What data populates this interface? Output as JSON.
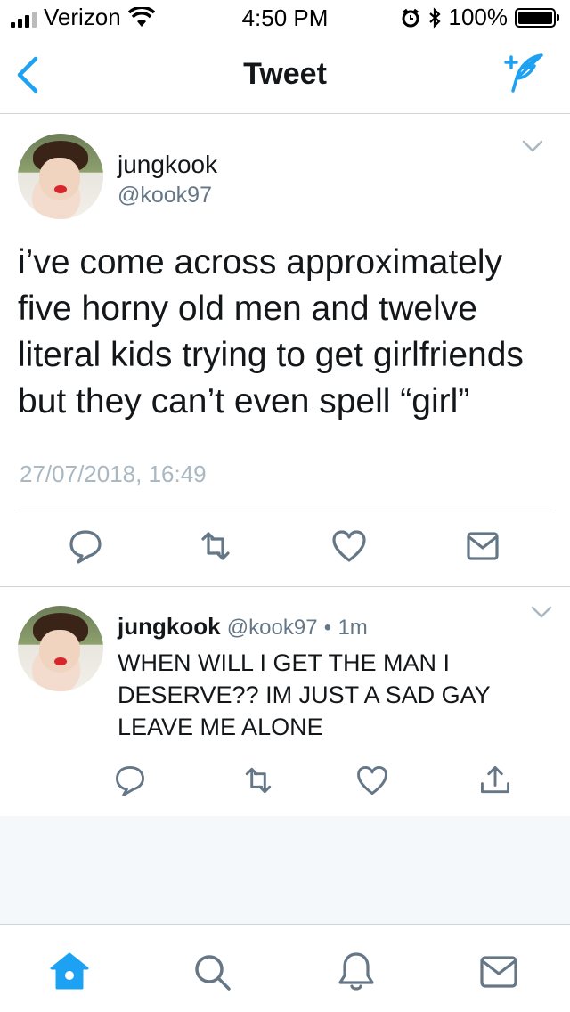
{
  "status_bar": {
    "carrier": "Verizon",
    "time": "4:50 PM",
    "battery": "100%"
  },
  "nav": {
    "title": "Tweet"
  },
  "main_tweet": {
    "name": "jungkook",
    "handle": "@kook97",
    "text": "i’ve come across approximately five horny old men and twelve literal kids trying to get girlfriends but they can’t even spell “girl”",
    "timestamp": "27/07/2018, 16:49"
  },
  "reply_tweet": {
    "name": "jungkook",
    "handle": "@kook97",
    "dot": "•",
    "time": "1m",
    "text": "WHEN WILL I GET THE MAN I DESERVE?? IM JUST A SAD GAY LEAVE ME ALONE"
  },
  "icons": {
    "back": "chevron-left-icon",
    "compose": "compose-tweet-icon",
    "reply": "reply-icon",
    "retweet": "retweet-icon",
    "like": "heart-icon",
    "dm": "envelope-icon",
    "share": "share-icon",
    "home": "home-icon",
    "search": "search-icon",
    "notifications": "bell-icon",
    "messages": "envelope-icon"
  },
  "colors": {
    "accent": "#1da1f2",
    "muted": "#657786",
    "text": "#14171a"
  }
}
